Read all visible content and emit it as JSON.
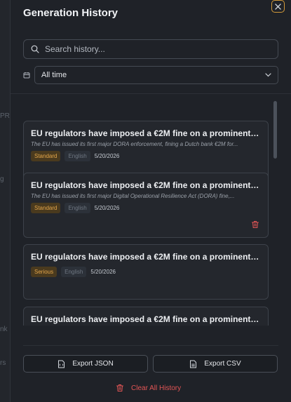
{
  "background_hints": [
    "PR",
    "g",
    "rs",
    "nk"
  ],
  "header": {
    "title": "Generation History"
  },
  "search": {
    "placeholder": "Search history..."
  },
  "filter": {
    "selected": "All time"
  },
  "history": [
    {
      "title": "EU regulators have imposed a €2M fine on a prominent Dutch...",
      "snippet": "The EU has issued its first major DORA enforcement, fining a Dutch bank €2M for...",
      "tone": "Standard",
      "language": "English",
      "date": "5/20/2026"
    },
    {
      "title": "EU regulators have imposed a €2M fine on a prominent Dutch...",
      "snippet": "The EU has issued its first major Digital Operational Resilience Act (DORA) fine,...",
      "tone": "Standard",
      "language": "English",
      "date": "5/20/2026"
    },
    {
      "title": "EU regulators have imposed a €2M fine on a prominent Dutch...",
      "snippet": "",
      "tone": "Serious",
      "language": "English",
      "date": "5/20/2026"
    },
    {
      "title": "EU regulators have imposed a €2M fine on a prominent Dutch...",
      "snippet": "",
      "tone": "",
      "language": "",
      "date": ""
    }
  ],
  "footer": {
    "export_json": "Export JSON",
    "export_csv": "Export CSV",
    "clear_all": "Clear All History"
  },
  "colors": {
    "accent": "#d29a3a",
    "danger": "#e25555",
    "tone_badge": "#e4a64a"
  }
}
